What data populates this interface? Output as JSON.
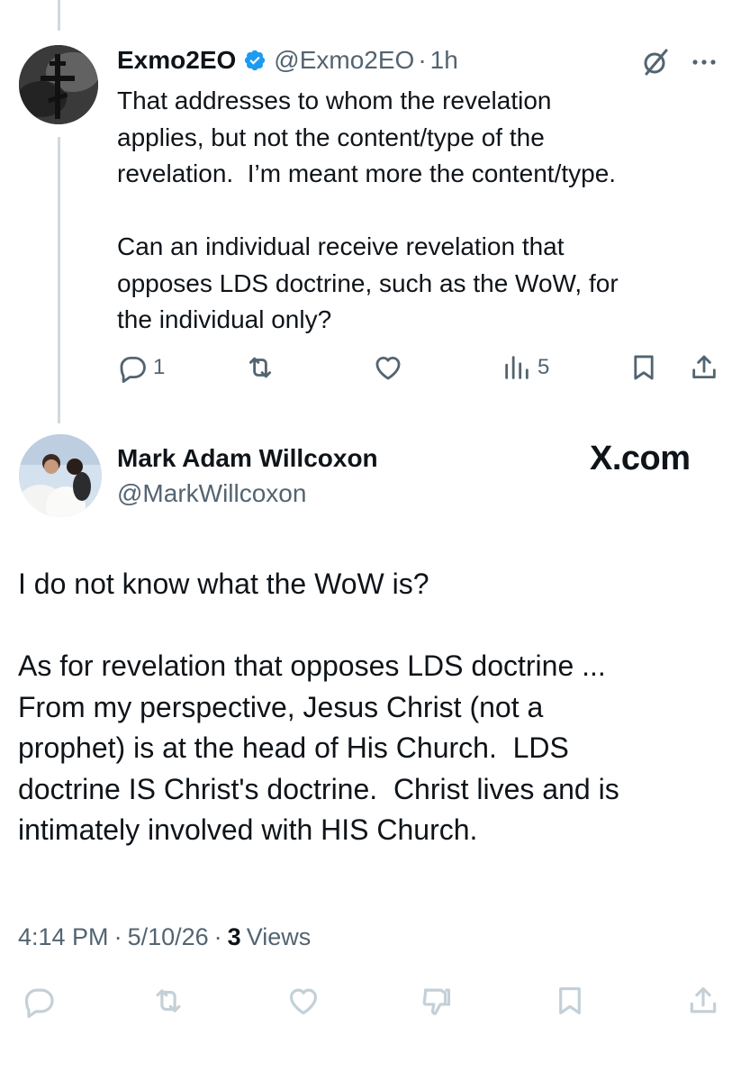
{
  "reply_tweet": {
    "name": "Exmo2EO",
    "handle": "@Exmo2EO",
    "dot": "·",
    "time": "1h",
    "text": "That addresses to whom the revelation\napplies, but not the content/type of the\nrevelation.  I’m meant more the content/type.\n\nCan an individual receive revelation that\nopposes LDS doctrine, such as the WoW, for\nthe individual only?",
    "reply_count": "1",
    "view_count": "5",
    "icons": {
      "avatar": "orthodox-cross-avatar",
      "verified": "verified-badge-icon",
      "grok": "grok-icon",
      "more": "more-icon",
      "reply": "reply-icon",
      "retweet": "retweet-icon",
      "like": "like-icon",
      "views": "views-icon",
      "bookmark": "bookmark-icon",
      "share": "share-icon"
    },
    "accent_color": "#1d9bf0"
  },
  "main_tweet": {
    "name": "Mark Adam Willcoxon",
    "handle": "@MarkWillcoxon",
    "brand": "X.com",
    "text": "I do not know what the WoW is?\n\nAs for revelation that opposes LDS doctrine ...\nFrom my perspective, Jesus Christ (not a\nprophet) is at the head of His Church.  LDS\ndoctrine IS Christ's doctrine.  Christ lives and is\nintimately involved with HIS Church.",
    "time": "4:14 PM",
    "sep1": "·",
    "date": "5/10/26",
    "sep2": "·",
    "views_count": "3",
    "views_label": "Views"
  },
  "colors": {
    "text": "#0f1419",
    "secondary": "#536471",
    "faded_icon": "#c4d0d8",
    "thread_line": "#cfd9de"
  }
}
